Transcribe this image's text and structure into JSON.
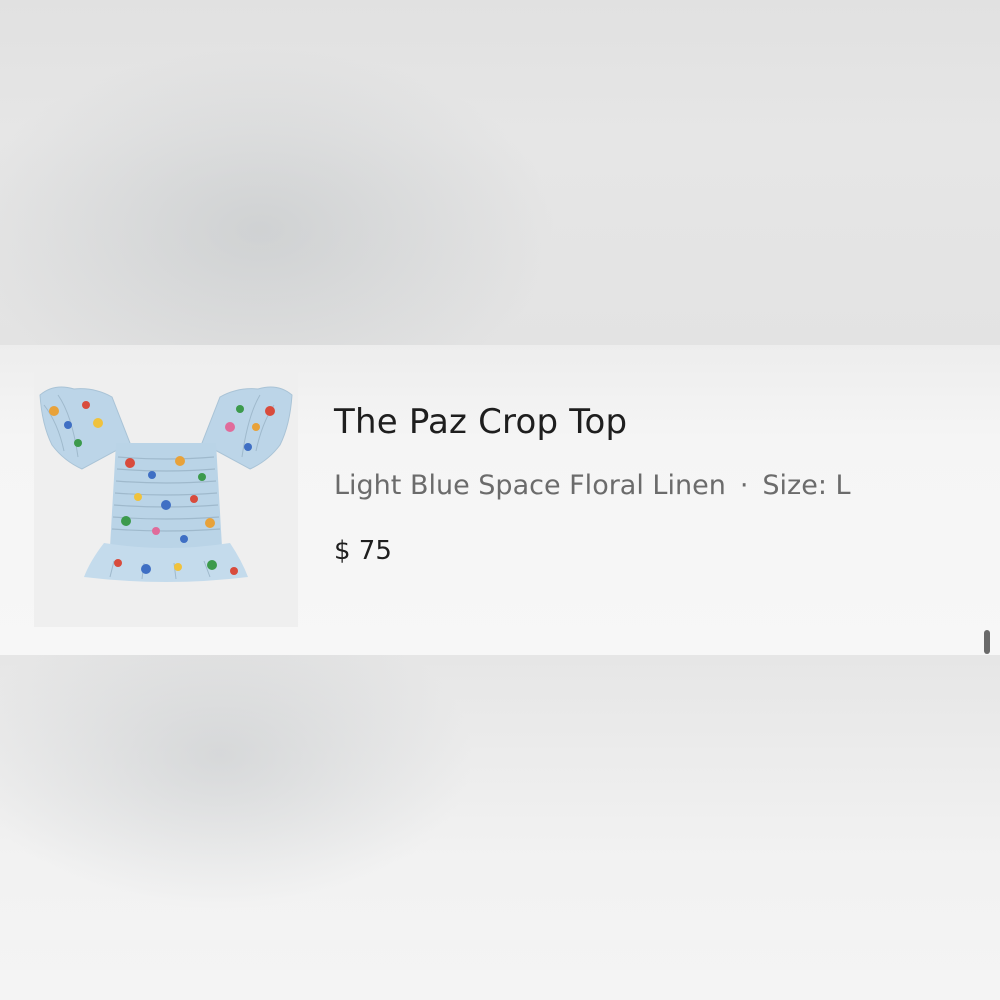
{
  "product": {
    "name": "The Paz Crop Top",
    "variant": "Light Blue Space Floral Linen",
    "separator": "·",
    "size": "Size: L",
    "price": "$ 75",
    "image_alt": "light blue floral smocked crop top with ruffle sleeves"
  },
  "colors": {
    "fabric": "#b9d3e6",
    "background": "#efefef"
  }
}
